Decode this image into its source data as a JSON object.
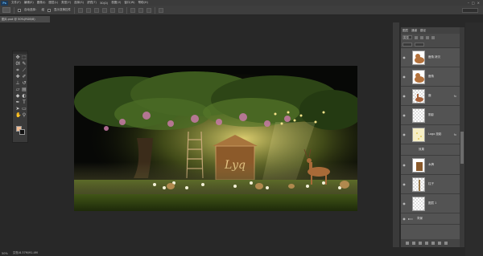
{
  "app": {
    "logo": "Ps",
    "menu": [
      "文件(F)",
      "编辑(E)",
      "图像(I)",
      "图层(L)",
      "类型(Y)",
      "选择(S)",
      "滤镜(T)",
      "3D(D)",
      "视图(V)",
      "窗口(W)",
      "帮助(H)"
    ],
    "window_controls": [
      "–",
      "□",
      "×"
    ]
  },
  "options": {
    "auto_select_label": "自动选择：",
    "target": "组",
    "transform_label": "显示变换控件"
  },
  "document": {
    "tab_label": "图片.psd @ 50%(RGB/8)",
    "status_zoom": "50%",
    "status_doc": "文档:8.37M/91.4M"
  },
  "tools": [
    "move",
    "marquee",
    "lasso",
    "quick-select",
    "crop",
    "eyedropper",
    "heal",
    "brush",
    "stamp",
    "history",
    "eraser",
    "gradient",
    "blur",
    "dodge",
    "pen",
    "type",
    "path-select",
    "shape",
    "hand",
    "zoom"
  ],
  "colors": {
    "foreground": "#f2bc92",
    "background": "#111111"
  },
  "layers": {
    "tabs": [
      "图层",
      "通道",
      "路径"
    ],
    "filter_label": "类型",
    "items": [
      {
        "name": "鹿角 拷贝",
        "fx": "",
        "thumb": "deer"
      },
      {
        "name": "鹿角",
        "fx": "",
        "thumb": "deer"
      },
      {
        "name": "鹿",
        "fx": "fx",
        "thumb": "deer2"
      },
      {
        "name": "阴影",
        "fx": "",
        "thumb": "checker"
      },
      {
        "name": "Logo 投影",
        "fx": "fx",
        "thumb": "sparkle"
      },
      {
        "name": "效果",
        "fx": "",
        "thumb": "fx"
      },
      {
        "name": "木牌",
        "fx": "",
        "thumb": "sign"
      },
      {
        "name": "柱子",
        "fx": "",
        "thumb": "post"
      },
      {
        "name": "图层 1",
        "fx": "",
        "thumb": "checker"
      },
      {
        "name": "背景",
        "fx": "",
        "thumb": "folder"
      }
    ]
  },
  "canvas": {
    "sign_text": "Lyq"
  }
}
